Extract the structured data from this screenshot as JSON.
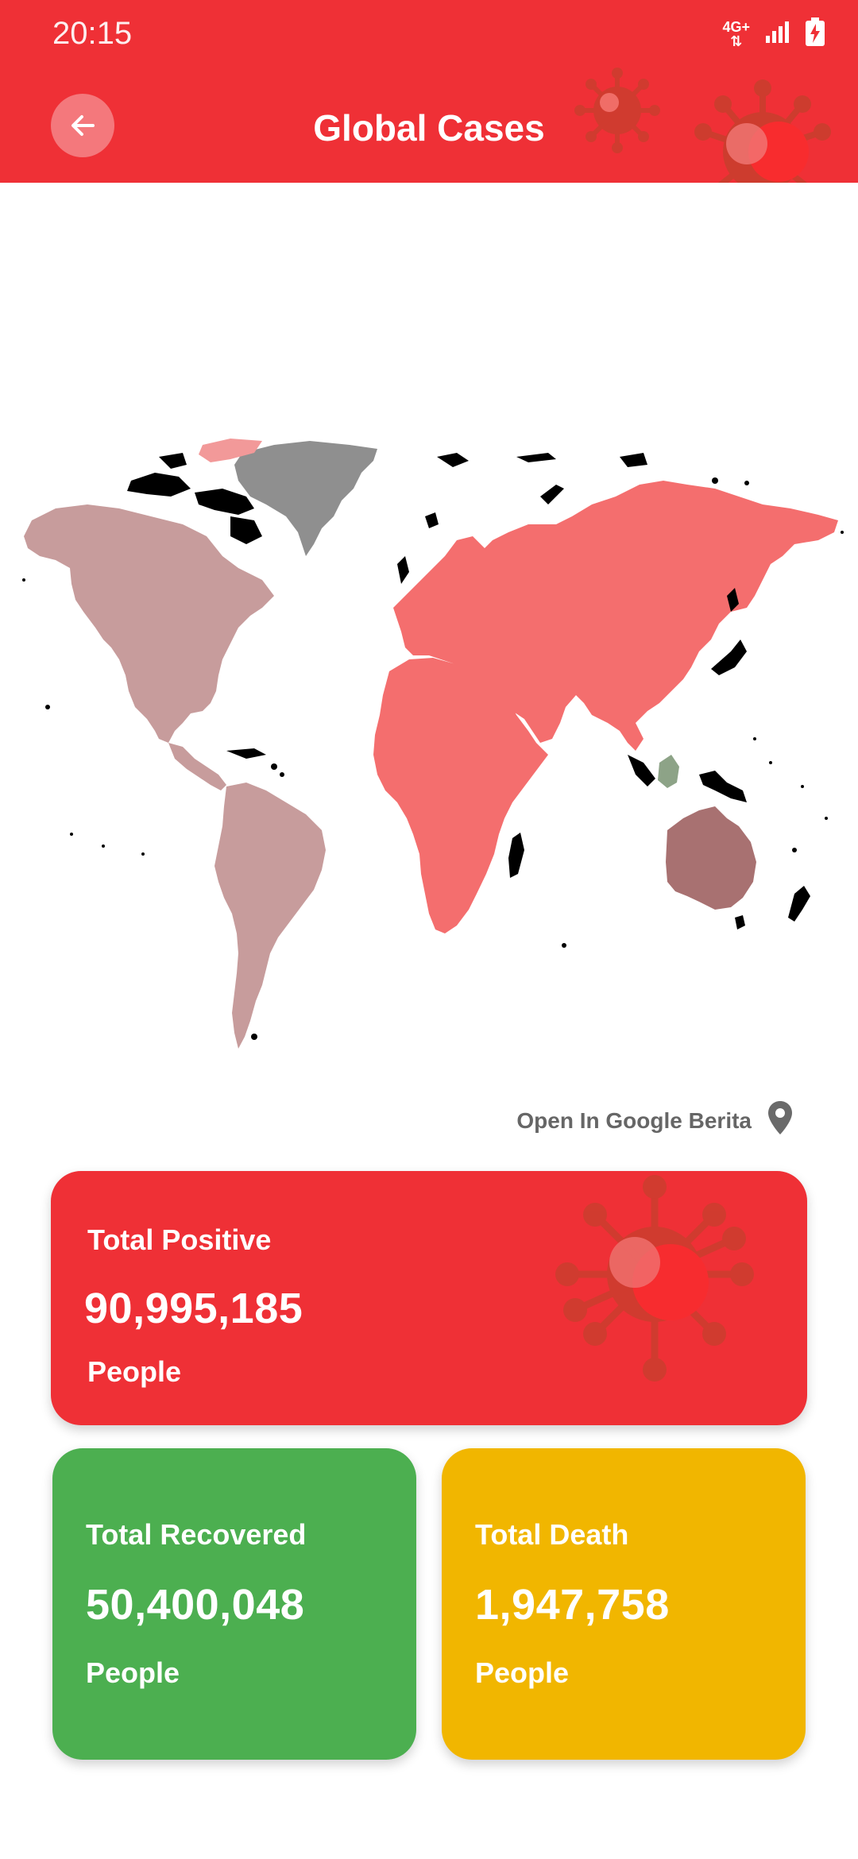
{
  "status_bar": {
    "time": "20:15",
    "network": "4G+",
    "icons": [
      "network-4g-icon",
      "signal-icon",
      "battery-charging-icon"
    ]
  },
  "header": {
    "title": "Global Cases",
    "back_icon": "arrow-left-icon"
  },
  "map": {
    "regions": [
      {
        "name": "North America",
        "color": "#c79c9c"
      },
      {
        "name": "South America",
        "color": "#c79c9c"
      },
      {
        "name": "Europe / Asia / Africa",
        "color": "#f46e6e"
      },
      {
        "name": "Oceania",
        "color": "#a87171"
      },
      {
        "name": "Greenland",
        "color": "#8f8f8f"
      },
      {
        "name": "Indonesia",
        "color": "#8da387"
      }
    ]
  },
  "link": {
    "label": "Open In Google Berita",
    "icon": "location-pin-icon"
  },
  "cards": {
    "positive": {
      "label": "Total Positive",
      "value": "90,995,185",
      "unit": "People",
      "color": "#ef3036"
    },
    "recovered": {
      "label": "Total Recovered",
      "value": "50,400,048",
      "unit": "People",
      "color": "#4caf50"
    },
    "death": {
      "label": "Total Death",
      "value": "1,947,758",
      "unit": "People",
      "color": "#f1b600"
    }
  }
}
